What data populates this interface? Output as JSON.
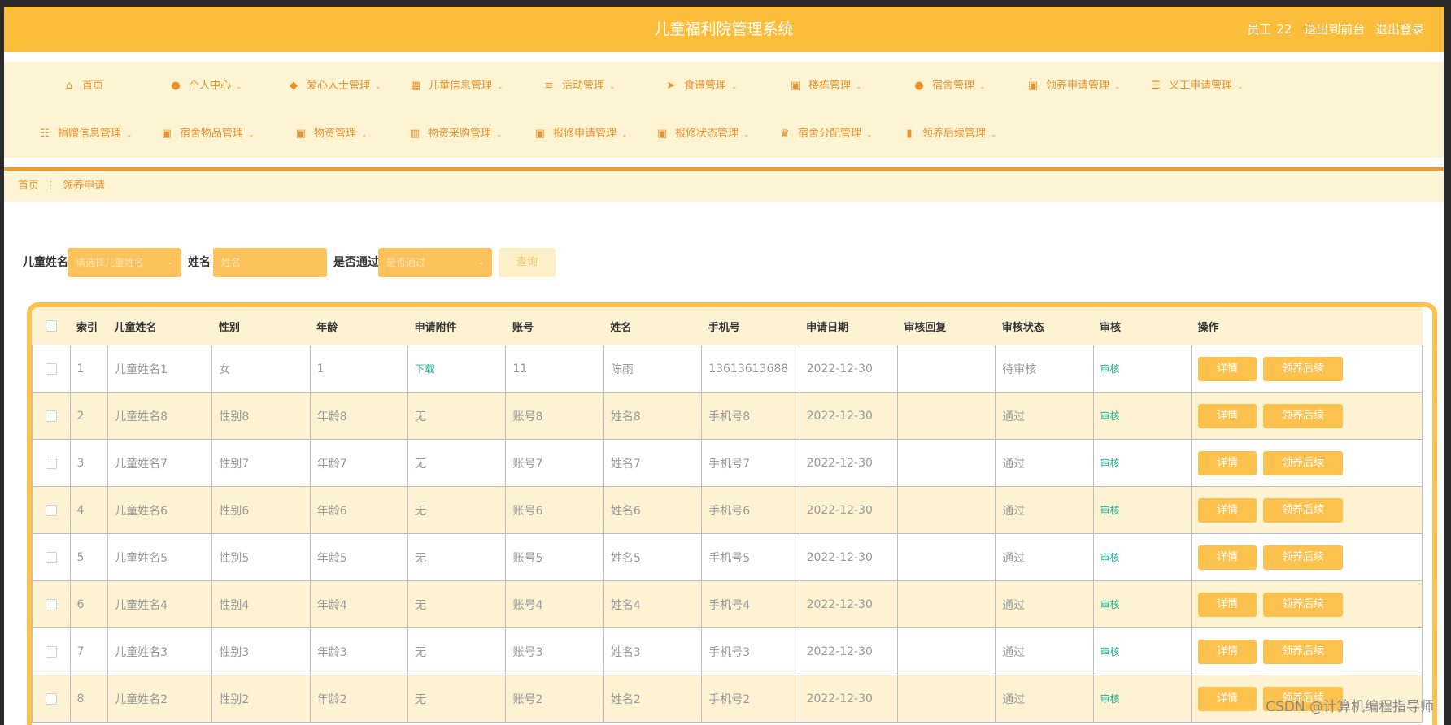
{
  "header": {
    "title": "儿童福利院管理系统",
    "role": "员工",
    "user_id": "22",
    "back_label": "退出到前台",
    "logout_label": "退出登录"
  },
  "nav": {
    "row1": [
      {
        "label": "首页",
        "icon": "home-icon",
        "glyph": "⌂",
        "chevron": false
      },
      {
        "label": "个人中心",
        "icon": "user-icon",
        "glyph": "●",
        "chevron": true
      },
      {
        "label": "爱心人士管理",
        "icon": "pin-icon",
        "glyph": "◆",
        "chevron": true
      },
      {
        "label": "儿童信息管理",
        "icon": "grid-icon",
        "glyph": "▦",
        "chevron": true
      },
      {
        "label": "活动管理",
        "icon": "list-icon",
        "glyph": "≡",
        "chevron": true
      },
      {
        "label": "食谱管理",
        "icon": "send-icon",
        "glyph": "➤",
        "chevron": true
      },
      {
        "label": "楼栋管理",
        "icon": "apps-icon",
        "glyph": "▣",
        "chevron": true
      },
      {
        "label": "宿舍管理",
        "icon": "person-icon",
        "glyph": "●",
        "chevron": true
      },
      {
        "label": "领养申请管理",
        "icon": "apps-icon",
        "glyph": "▣",
        "chevron": true
      },
      {
        "label": "义工申请管理",
        "icon": "menu-icon",
        "glyph": "☰",
        "chevron": true
      }
    ],
    "row2": [
      {
        "label": "捐赠信息管理",
        "icon": "sliders-icon",
        "glyph": "☷",
        "chevron": true
      },
      {
        "label": "宿舍物品管理",
        "icon": "apps-icon",
        "glyph": "▣",
        "chevron": true
      },
      {
        "label": "物资管理",
        "icon": "apps-icon",
        "glyph": "▣",
        "chevron": true
      },
      {
        "label": "物资采购管理",
        "icon": "book-icon",
        "glyph": "▥",
        "chevron": true
      },
      {
        "label": "报修申请管理",
        "icon": "apps-icon",
        "glyph": "▣",
        "chevron": true
      },
      {
        "label": "报修状态管理",
        "icon": "apps-icon",
        "glyph": "▣",
        "chevron": true
      },
      {
        "label": "宿舍分配管理",
        "icon": "trophy-icon",
        "glyph": "♛",
        "chevron": true
      },
      {
        "label": "领养后续管理",
        "icon": "bar-chart-icon",
        "glyph": "▮",
        "chevron": true
      }
    ]
  },
  "breadcrumb": {
    "home": "首页",
    "separator": "⋮",
    "current": "领养申请"
  },
  "search": {
    "child_label": "儿童姓名",
    "child_placeholder": "请选择儿童姓名",
    "name_label": "姓名",
    "name_placeholder": "姓名",
    "pass_label": "是否通过",
    "pass_placeholder": "是否通过",
    "button": "查询"
  },
  "table": {
    "columns": [
      "索引",
      "儿童姓名",
      "性别",
      "年龄",
      "申请附件",
      "账号",
      "姓名",
      "手机号",
      "申请日期",
      "审核回复",
      "审核状态",
      "审核",
      "操作"
    ],
    "detail_label": "详情",
    "follow_label": "领养后续",
    "rows": [
      {
        "index": "1",
        "child": "儿童姓名1",
        "gender": "女",
        "age": "1",
        "attachment": "下载",
        "account": "11",
        "name": "陈雨",
        "phone": "13613613688",
        "date": "2022-12-30",
        "reply": "",
        "status": "待审核",
        "review": "审核"
      },
      {
        "index": "2",
        "child": "儿童姓名8",
        "gender": "性别8",
        "age": "年龄8",
        "attachment": "无",
        "account": "账号8",
        "name": "姓名8",
        "phone": "手机号8",
        "date": "2022-12-30",
        "reply": "",
        "status": "通过",
        "review": "审核"
      },
      {
        "index": "3",
        "child": "儿童姓名7",
        "gender": "性别7",
        "age": "年龄7",
        "attachment": "无",
        "account": "账号7",
        "name": "姓名7",
        "phone": "手机号7",
        "date": "2022-12-30",
        "reply": "",
        "status": "通过",
        "review": "审核"
      },
      {
        "index": "4",
        "child": "儿童姓名6",
        "gender": "性别6",
        "age": "年龄6",
        "attachment": "无",
        "account": "账号6",
        "name": "姓名6",
        "phone": "手机号6",
        "date": "2022-12-30",
        "reply": "",
        "status": "通过",
        "review": "审核"
      },
      {
        "index": "5",
        "child": "儿童姓名5",
        "gender": "性别5",
        "age": "年龄5",
        "attachment": "无",
        "account": "账号5",
        "name": "姓名5",
        "phone": "手机号5",
        "date": "2022-12-30",
        "reply": "",
        "status": "通过",
        "review": "审核"
      },
      {
        "index": "6",
        "child": "儿童姓名4",
        "gender": "性别4",
        "age": "年龄4",
        "attachment": "无",
        "account": "账号4",
        "name": "姓名4",
        "phone": "手机号4",
        "date": "2022-12-30",
        "reply": "",
        "status": "通过",
        "review": "审核"
      },
      {
        "index": "7",
        "child": "儿童姓名3",
        "gender": "性别3",
        "age": "年龄3",
        "attachment": "无",
        "account": "账号3",
        "name": "姓名3",
        "phone": "手机号3",
        "date": "2022-12-30",
        "reply": "",
        "status": "通过",
        "review": "审核"
      },
      {
        "index": "8",
        "child": "儿童姓名2",
        "gender": "性别2",
        "age": "年龄2",
        "attachment": "无",
        "account": "账号2",
        "name": "姓名2",
        "phone": "手机号2",
        "date": "2022-12-30",
        "reply": "",
        "status": "通过",
        "review": "审核"
      }
    ]
  },
  "watermark": "CSDN @计算机编程指导师",
  "colors": {
    "accent": "#fcbd3a",
    "nav_bg": "#fdf4d4",
    "nav_text": "#e8912e",
    "link": "#1ab394"
  }
}
